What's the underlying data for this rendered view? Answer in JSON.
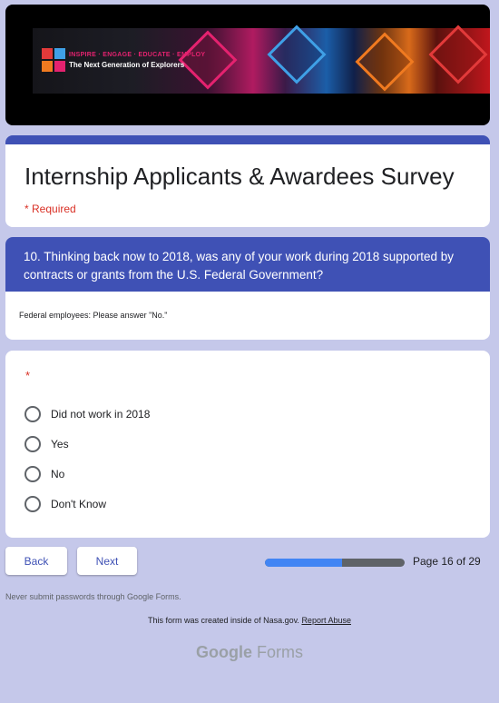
{
  "banner": {
    "tagline": "INSPIRE · ENGAGE · EDUCATE · EMPLOY",
    "subtitle": "The Next Generation of Explorers"
  },
  "form": {
    "title": "Internship Applicants & Awardees Survey",
    "required_note": "* Required"
  },
  "question": {
    "text": "10. Thinking back now to 2018, was any of your work during 2018 supported by contracts or grants from the U.S. Federal Government?",
    "help": "Federal employees: Please answer \"No.\"",
    "required_mark": "*",
    "options": [
      "Did not work in 2018",
      "Yes",
      "No",
      "Don't Know"
    ]
  },
  "nav": {
    "back_label": "Back",
    "next_label": "Next",
    "page_label": "Page 16 of 29",
    "progress": 0.55
  },
  "footer": {
    "password_warning": "Never submit passwords through Google Forms.",
    "created_text": "This form was created inside of Nasa.gov.",
    "report_label": "Report Abuse",
    "brand_google": "Google",
    "brand_forms": "Forms"
  },
  "colors": {
    "theme": "#3f51b5",
    "background": "#c5c8ea",
    "required": "#d93025",
    "progress_fill": "#4285f4"
  }
}
